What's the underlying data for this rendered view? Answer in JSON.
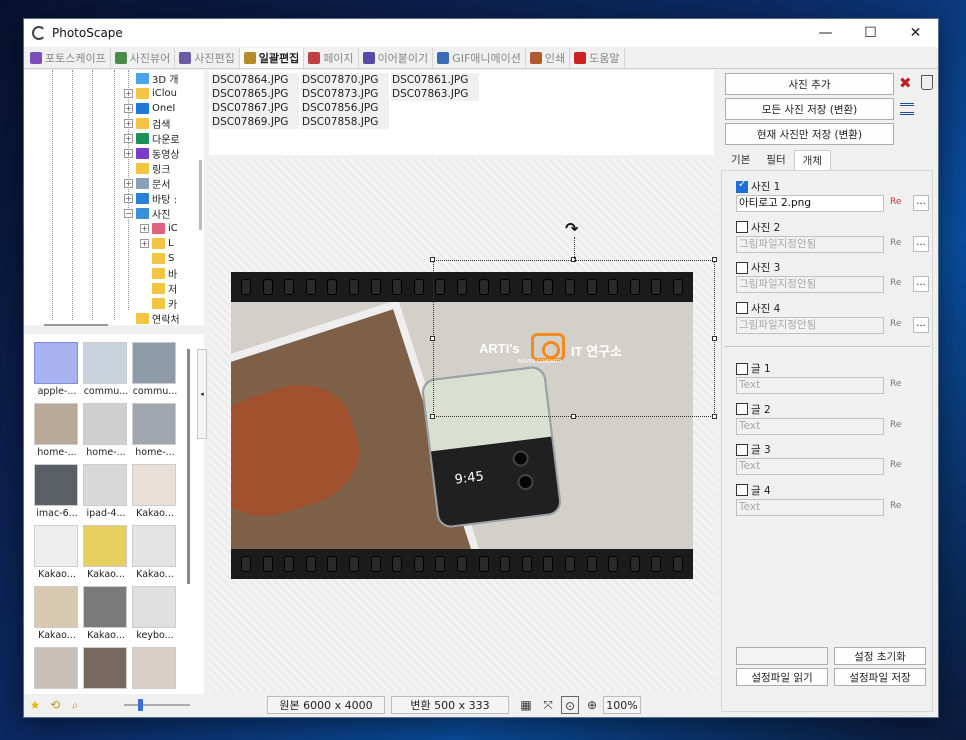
{
  "window": {
    "title": "PhotoScape",
    "min": "—",
    "max": "☐",
    "close": "✕"
  },
  "tabs": [
    {
      "label": "포토스케이프",
      "color": "#7b4fb8",
      "active": false
    },
    {
      "label": "사진뷰어",
      "color": "#4a8c4a",
      "active": false
    },
    {
      "label": "사진편집",
      "color": "#6a5aa8",
      "active": false
    },
    {
      "label": "일괄편집",
      "color": "#b58a2a",
      "active": true
    },
    {
      "label": "페이지",
      "color": "#c04040",
      "active": false
    },
    {
      "label": "이어붙이기",
      "color": "#5a4aa8",
      "active": false
    },
    {
      "label": "GIF애니메이션",
      "color": "#3a6ab8",
      "active": false
    },
    {
      "label": "인쇄",
      "color": "#b05a30",
      "active": false
    },
    {
      "label": "도움말",
      "color": "#cc2222",
      "active": false
    }
  ],
  "tree": {
    "items": [
      {
        "label": "3D 개",
        "icon": "3d-folder-icon"
      },
      {
        "label": "iClou",
        "icon": "folder-icon"
      },
      {
        "label": "OneI",
        "icon": "onedrive-icon"
      },
      {
        "label": "검색",
        "icon": "folder-icon"
      },
      {
        "label": "다운로",
        "icon": "download-icon"
      },
      {
        "label": "동영상",
        "icon": "video-icon"
      },
      {
        "label": "링크",
        "icon": "folder-icon"
      },
      {
        "label": "문서",
        "icon": "document-icon"
      },
      {
        "label": "바탕 :",
        "icon": "desktop-icon"
      },
      {
        "label": "사진",
        "icon": "pictures-icon"
      },
      {
        "label": "iC",
        "icon": "photos-icon"
      },
      {
        "label": "L",
        "icon": "folder-icon"
      },
      {
        "label": "S",
        "icon": "folder-icon"
      },
      {
        "label": "바",
        "icon": "folder-icon"
      },
      {
        "label": "저",
        "icon": "folder-icon"
      },
      {
        "label": "카",
        "icon": "folder-icon"
      },
      {
        "label": "연락처",
        "icon": "folder-icon"
      }
    ]
  },
  "thumbs": [
    {
      "cap": "apple-...",
      "sel": true
    },
    {
      "cap": "commu...",
      "sel": false
    },
    {
      "cap": "commu...",
      "sel": false
    },
    {
      "cap": "home-...",
      "sel": false
    },
    {
      "cap": "home-...",
      "sel": false
    },
    {
      "cap": "home-...",
      "sel": false
    },
    {
      "cap": "imac-6...",
      "sel": false
    },
    {
      "cap": "ipad-4...",
      "sel": false
    },
    {
      "cap": "Kakao...",
      "sel": false
    },
    {
      "cap": "Kakao...",
      "sel": false
    },
    {
      "cap": "Kakao...",
      "sel": false
    },
    {
      "cap": "Kakao...",
      "sel": false
    },
    {
      "cap": "Kakao...",
      "sel": false
    },
    {
      "cap": "Kakao...",
      "sel": false
    },
    {
      "cap": "keybo...",
      "sel": false
    },
    {
      "cap": "",
      "sel": false
    },
    {
      "cap": "",
      "sel": false
    },
    {
      "cap": "",
      "sel": false
    }
  ],
  "files": [
    "DSC07864.JPG",
    "DSC07870.JPG",
    "DSC07861.JPG",
    "DSC07865.JPG",
    "DSC07873.JPG",
    "DSC07863.JPG",
    "DSC07867.JPG",
    "DSC07856.JPG",
    "",
    "DSC07869.JPG",
    "DSC07858.JPG",
    ""
  ],
  "canvas": {
    "logo_left": "ARTI's",
    "logo_right": "IT 연구소",
    "logo_sub": "INAVER.COM/ARTI",
    "phone_time": "9:45",
    "rotate_icon": "↷",
    "close_icon": "✕"
  },
  "status": {
    "original": "원본 6000 x 4000",
    "converted": "변환 500 x 333",
    "zoom": "100%"
  },
  "right": {
    "add_photo": "사진 추가",
    "save_all": "모든 사진 저장 (변환)",
    "save_current": "현재 사진만 저장 (변환)",
    "subtabs": [
      "기본",
      "필터",
      "개체"
    ],
    "active_subtab": 2,
    "photos": [
      {
        "label": "사진 1",
        "checked": true,
        "value": "아티로고 2.png",
        "dim": false
      },
      {
        "label": "사진 2",
        "checked": false,
        "value": "그림파일지정안됨",
        "dim": true
      },
      {
        "label": "사진 3",
        "checked": false,
        "value": "그림파일지정안됨",
        "dim": true
      },
      {
        "label": "사진 4",
        "checked": false,
        "value": "그림파일지정안됨",
        "dim": true
      }
    ],
    "texts": [
      {
        "label": "글 1",
        "checked": false,
        "placeholder": "Text"
      },
      {
        "label": "글 2",
        "checked": false,
        "placeholder": "Text"
      },
      {
        "label": "글 3",
        "checked": false,
        "placeholder": "Text"
      },
      {
        "label": "글 4",
        "checked": false,
        "placeholder": "Text"
      }
    ],
    "reset_settings": "설정 초기화",
    "load_settings": "설정파일 읽기",
    "save_settings": "설정파일 저장",
    "edit_icon_label": "Re",
    "dots_label": "..."
  }
}
